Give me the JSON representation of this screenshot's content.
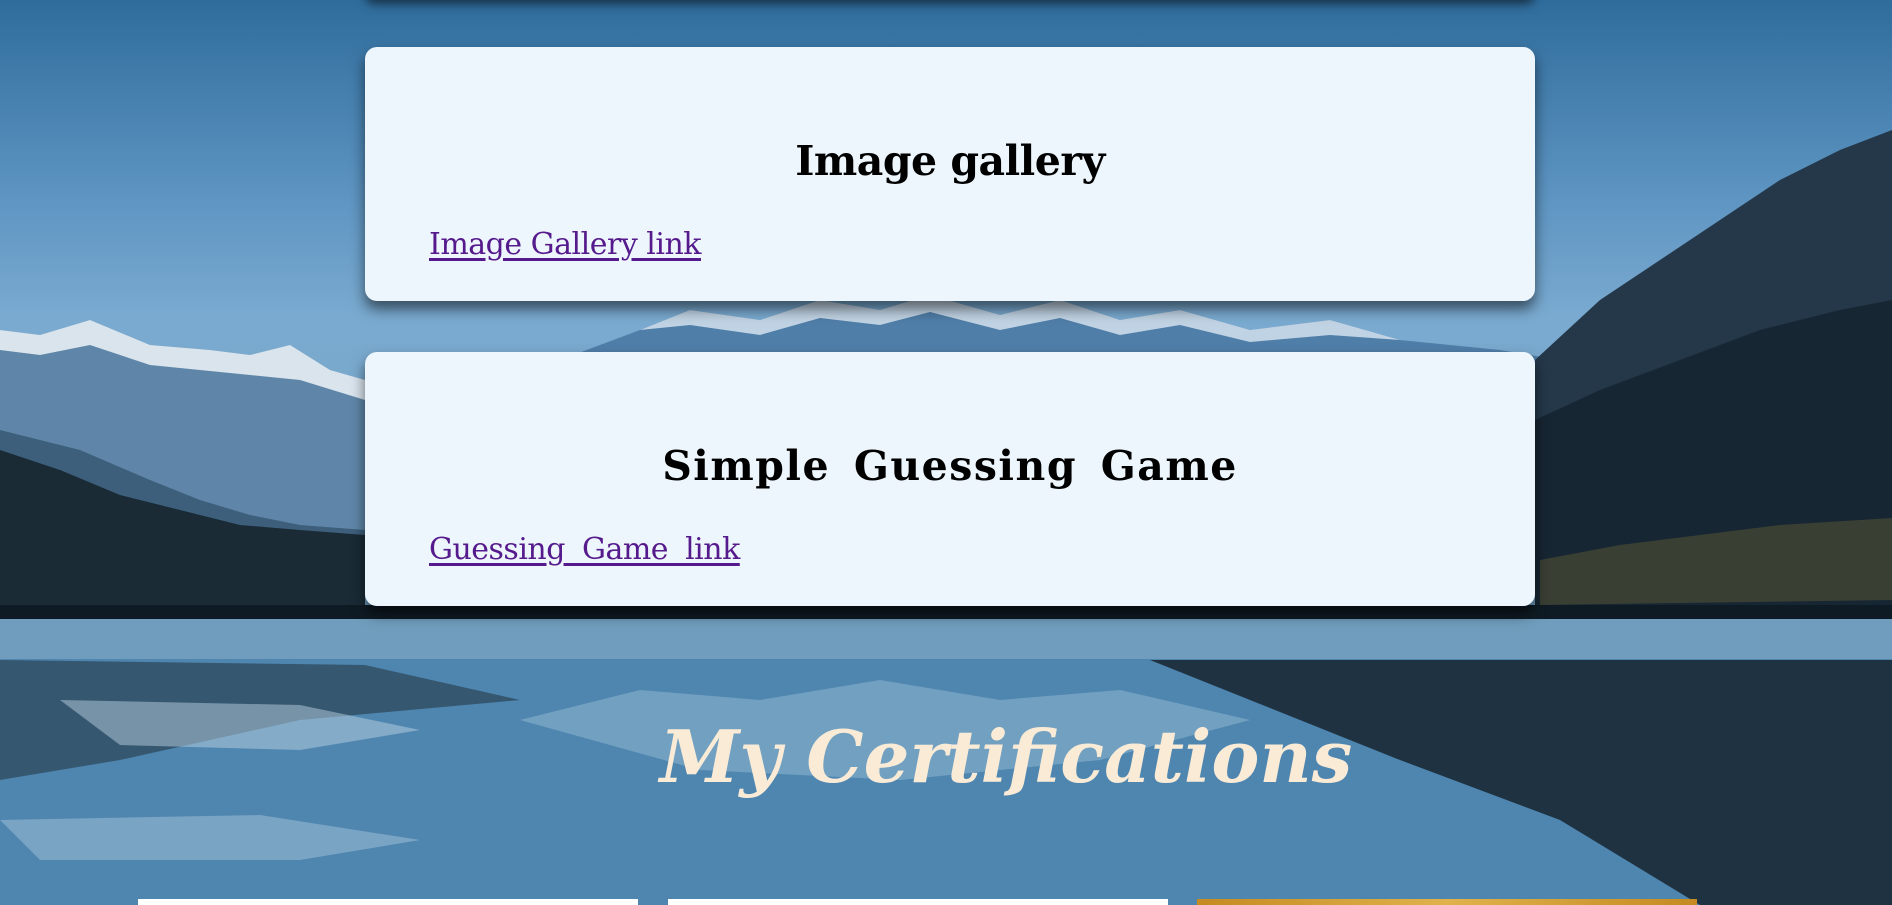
{
  "projects": [
    {
      "title": "Image gallery",
      "link": "Image Gallery link"
    },
    {
      "title": "Simple Guessing Game",
      "link": "Guessing Game link"
    }
  ],
  "certifications": {
    "heading": "My Certifications"
  },
  "colors": {
    "card_bg": "#eef6fd",
    "link": "#551a8b",
    "heading": "#faebd7",
    "sky": "#5e95c2",
    "water": "#4f86b0"
  }
}
